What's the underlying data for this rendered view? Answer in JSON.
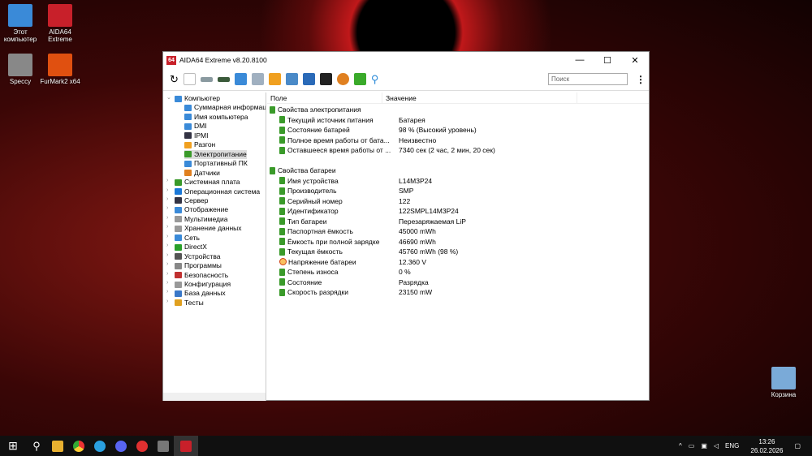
{
  "desktop": {
    "icons": [
      {
        "label": "Этот компьютер",
        "color": "#3a8ad8"
      },
      {
        "label": "AIDA64 Extreme",
        "color": "#c8202a"
      },
      {
        "label": "Speccy",
        "color": "#888"
      },
      {
        "label": "FurMark2 x64",
        "color": "#e05010"
      },
      {
        "label": "Корзина",
        "color": "#7aaad8"
      }
    ]
  },
  "window": {
    "title": "AIDA64 Extreme v8.20.8100",
    "logo": "64",
    "search_placeholder": "Поиск"
  },
  "tree": [
    {
      "label": "Компьютер",
      "level": 0,
      "expanded": true,
      "color": "#3a8ad8"
    },
    {
      "label": "Суммарная информация",
      "level": 1,
      "color": "#3a8ad8"
    },
    {
      "label": "Имя компьютера",
      "level": 1,
      "color": "#3a8ad8"
    },
    {
      "label": "DMI",
      "level": 1,
      "color": "#3a8ad8"
    },
    {
      "label": "IPMI",
      "level": 1,
      "color": "#334"
    },
    {
      "label": "Разгон",
      "level": 1,
      "color": "#f0a020"
    },
    {
      "label": "Электропитание",
      "level": 1,
      "color": "#3a9a2a",
      "selected": true
    },
    {
      "label": "Портативный ПК",
      "level": 1,
      "color": "#3a8ad8"
    },
    {
      "label": "Датчики",
      "level": 1,
      "color": "#e08020"
    },
    {
      "label": "Системная плата",
      "level": 0,
      "color": "#3a9a2a"
    },
    {
      "label": "Операционная система",
      "level": 0,
      "color": "#1a78d8"
    },
    {
      "label": "Сервер",
      "level": 0,
      "color": "#334"
    },
    {
      "label": "Отображение",
      "level": 0,
      "color": "#3a8ad8"
    },
    {
      "label": "Мультимедиа",
      "level": 0,
      "color": "#999"
    },
    {
      "label": "Хранение данных",
      "level": 0,
      "color": "#999"
    },
    {
      "label": "Сеть",
      "level": 0,
      "color": "#3a8ad8"
    },
    {
      "label": "DirectX",
      "level": 0,
      "color": "#2aa02a"
    },
    {
      "label": "Устройства",
      "level": 0,
      "color": "#555"
    },
    {
      "label": "Программы",
      "level": 0,
      "color": "#888"
    },
    {
      "label": "Безопасность",
      "level": 0,
      "color": "#c03030"
    },
    {
      "label": "Конфигурация",
      "level": 0,
      "color": "#999"
    },
    {
      "label": "База данных",
      "level": 0,
      "color": "#3a78c8"
    },
    {
      "label": "Тесты",
      "level": 0,
      "color": "#e0a020"
    }
  ],
  "columns": {
    "field": "Поле",
    "value": "Значение"
  },
  "rows": [
    {
      "field": "Свойства электропитания",
      "group": true,
      "slot": 0
    },
    {
      "field": "Текущий источник питания",
      "value": "Батарея",
      "slot": 1
    },
    {
      "field": "Состояние батарей",
      "value": "98 % (Высокий уровень)",
      "slot": 2
    },
    {
      "field": "Полное время работы от бата...",
      "value": "Неизвестно",
      "slot": 3
    },
    {
      "field": "Оставшееся время работы от ...",
      "value": "7340 сек (2 час, 2 мин, 20 сек)",
      "slot": 4
    },
    {
      "field": "Свойства батареи",
      "group": true,
      "slot": 6
    },
    {
      "field": "Имя устройства",
      "value": "L14M3P24",
      "slot": 7
    },
    {
      "field": "Производитель",
      "value": "SMP",
      "slot": 8
    },
    {
      "field": "Серийный номер",
      "value": "122",
      "slot": 9
    },
    {
      "field": "Идентификатор",
      "value": "122SMPL14M3P24",
      "slot": 10
    },
    {
      "field": "Тип батареи",
      "value": "Перезаряжаемая LiP",
      "slot": 11
    },
    {
      "field": "Паспортная ёмкость",
      "value": "45000 mWh",
      "slot": 12
    },
    {
      "field": "Ёмкость при полной зарядке",
      "value": "46690 mWh",
      "slot": 13
    },
    {
      "field": "Текущая ёмкость",
      "value": "45760 mWh  (98 %)",
      "slot": 14
    },
    {
      "field": "Напряжение батареи",
      "value": "12.360 V",
      "slot": 15,
      "icon": "voltage"
    },
    {
      "field": "Степень износа",
      "value": "0 %",
      "slot": 16
    },
    {
      "field": "Состояние",
      "value": "Разрядка",
      "slot": 17
    },
    {
      "field": "Скорость разрядки",
      "value": "23150 mW",
      "slot": 18
    }
  ],
  "tray": {
    "lang": "ENG",
    "time": "13:26",
    "date": "26.02.2026"
  }
}
